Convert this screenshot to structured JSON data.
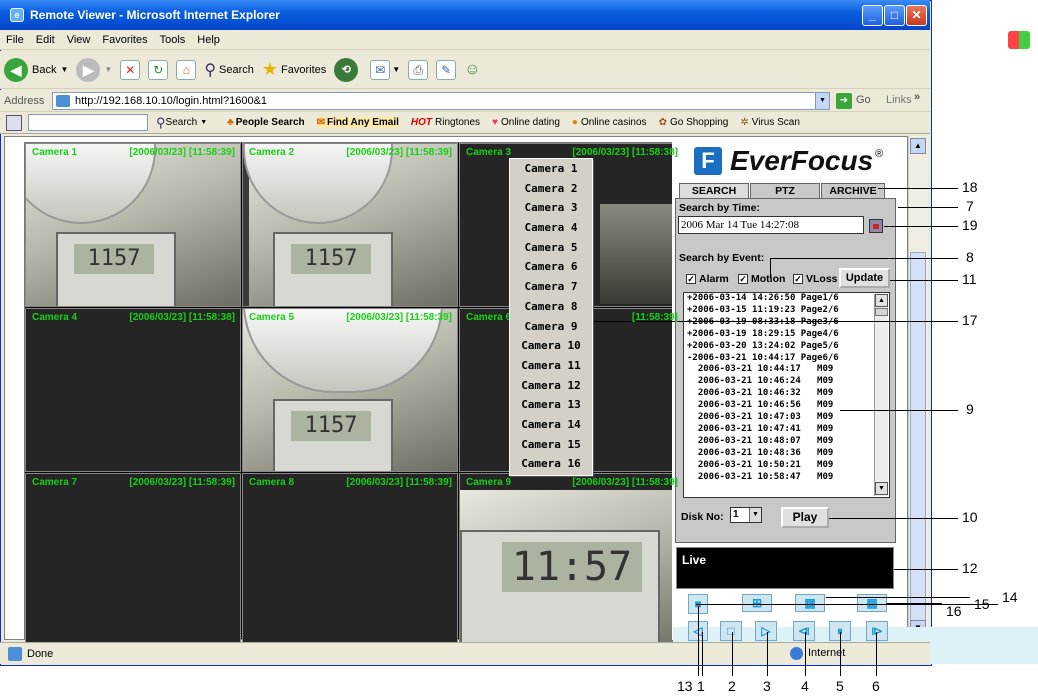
{
  "window": {
    "title": "Remote Viewer - Microsoft Internet Explorer"
  },
  "menu": [
    "File",
    "Edit",
    "View",
    "Favorites",
    "Tools",
    "Help"
  ],
  "toolbar": {
    "back": "Back",
    "search": "Search",
    "favorites": "Favorites"
  },
  "address": {
    "label": "Address",
    "url": "http://192.168.10.10/login.html?1600&1",
    "go": "Go",
    "links": "Links"
  },
  "linksbar": {
    "search": "Search",
    "items": [
      "People Search",
      "Find Any Email",
      "Ringtones",
      "Online dating",
      "Online casinos",
      "Go Shopping",
      "Virus Scan"
    ],
    "hot": "HOT"
  },
  "status": {
    "left": "Done",
    "zone": "Internet"
  },
  "cameras": [
    {
      "name": "Camera 1",
      "ts": "[2006/03/23] [11:58:39]"
    },
    {
      "name": "Camera 2",
      "ts": "[2006/03/23] [11:58:39]"
    },
    {
      "name": "Camera 3",
      "ts": "[2006/03/23] [11:58:38]"
    },
    {
      "name": "Camera 4",
      "ts": "[2006/03/23] [11:58:38]"
    },
    {
      "name": "Camera 5",
      "ts": "[2006/03/23] [11:58:39]"
    },
    {
      "name": "Camera 6",
      "ts": "[11:58:39]"
    },
    {
      "name": "Camera 7",
      "ts": "[2006/03/23] [11:58:39]"
    },
    {
      "name": "Camera 8",
      "ts": "[2006/03/23] [11:58:39]"
    },
    {
      "name": "Camera 9",
      "ts": "[2006/03/23] [11:58:39]"
    }
  ],
  "scene": {
    "clock1": "1157",
    "clock2": "11:57"
  },
  "camera_menu": [
    "Camera 1",
    "Camera 2",
    "Camera 3",
    "Camera 4",
    "Camera 5",
    "Camera 6",
    "Camera 7",
    "Camera 8",
    "Camera 9",
    "Camera 10",
    "Camera 11",
    "Camera 12",
    "Camera 13",
    "Camera 14",
    "Camera 15",
    "Camera 16"
  ],
  "brand": {
    "name": "EverFocus",
    "reg": "®",
    "mark": "F"
  },
  "tabs": [
    "SEARCH",
    "PTZ",
    "ARCHIVE"
  ],
  "search": {
    "time_label": "Search by Time:",
    "time_value": "2006 Mar 14 Tue  14:27:08",
    "event_label": "Search by Event:",
    "alarm": "Alarm",
    "motion": "Motion",
    "vloss": "VLoss",
    "update": "Update",
    "events": [
      "+2006-03-14 14:26:50 Page1/6",
      "+2006-03-15 11:19:23 Page2/6",
      "+2006-03-19 08:33:18 Page3/6",
      "+2006-03-19 18:29:15 Page4/6",
      "+2006-03-20 13:24:02 Page5/6",
      "-2006-03-21 10:44:17 Page6/6",
      "  2006-03-21 10:44:17   M09",
      "  2006-03-21 10:46:24   M09",
      "  2006-03-21 10:46:32   M09",
      "  2006-03-21 10:46:56   M09",
      "  2006-03-21 10:47:03   M09",
      "  2006-03-21 10:47:41   M09",
      "  2006-03-21 10:48:07   M09",
      "  2006-03-21 10:48:36   M09",
      "  2006-03-21 10:50:21   M09",
      "  2006-03-21 10:58:47   M09"
    ],
    "disk_label": "Disk No:",
    "disk_value": "1",
    "play": "Play"
  },
  "live": "Live",
  "callouts": {
    "c18": "18",
    "c7": "7",
    "c19": "19",
    "c8": "8",
    "c11": "11",
    "c17": "17",
    "c9": "9",
    "c10": "10",
    "c12": "12",
    "c14": "14",
    "c15": "15",
    "c16": "16",
    "c13": "13",
    "c1": "1",
    "c2": "2",
    "c3": "3",
    "c4": "4",
    "c5": "5",
    "c6": "6"
  }
}
